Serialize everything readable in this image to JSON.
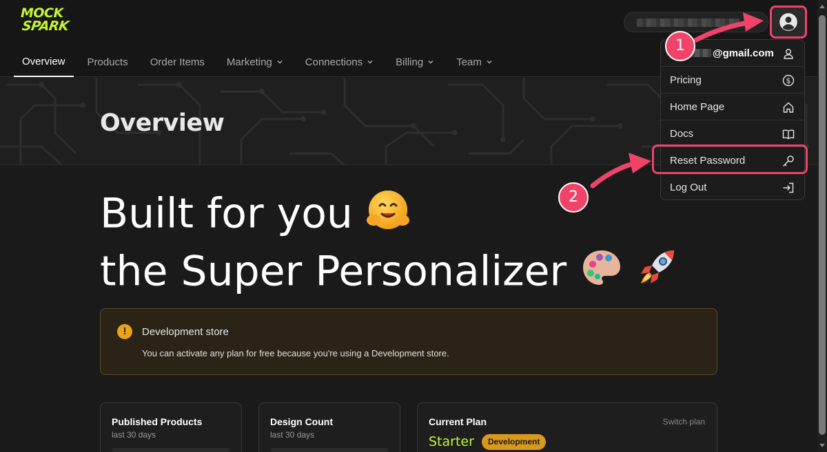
{
  "brand": {
    "logo_line1": "MOCK",
    "logo_line2": "SPARK",
    "accent": "#c6f432",
    "annotation_color": "#f0436a"
  },
  "header": {
    "store_name_redacted": ""
  },
  "nav": {
    "items": [
      {
        "label": "Overview",
        "active": true,
        "has_menu": false
      },
      {
        "label": "Products",
        "active": false,
        "has_menu": false
      },
      {
        "label": "Order Items",
        "active": false,
        "has_menu": false
      },
      {
        "label": "Marketing",
        "active": false,
        "has_menu": true
      },
      {
        "label": "Connections",
        "active": false,
        "has_menu": true
      },
      {
        "label": "Billing",
        "active": false,
        "has_menu": true
      },
      {
        "label": "Team",
        "active": false,
        "has_menu": true
      }
    ]
  },
  "hero": {
    "title": "Overview"
  },
  "headline": {
    "line1": "Built for you",
    "line2": "the Super Personalizer"
  },
  "alert": {
    "title": "Development store",
    "body": "You can activate any plan for free because you're using a Development store."
  },
  "cards": {
    "published": {
      "title": "Published Products",
      "sub": "last 30 days"
    },
    "designs": {
      "title": "Design Count",
      "sub": "last 30 days"
    },
    "plan": {
      "title": "Current Plan",
      "switch": "Switch plan",
      "name": "Starter",
      "badge": "Development"
    }
  },
  "user_menu": {
    "email": "@gmail.com",
    "items": [
      {
        "label": "Pricing",
        "icon": "dollar-icon"
      },
      {
        "label": "Home Page",
        "icon": "home-icon"
      },
      {
        "label": "Docs",
        "icon": "book-icon"
      },
      {
        "label": "Reset Password",
        "icon": "key-icon"
      },
      {
        "label": "Log Out",
        "icon": "logout-icon"
      }
    ]
  },
  "annotations": {
    "step1": "1",
    "step2": "2"
  }
}
